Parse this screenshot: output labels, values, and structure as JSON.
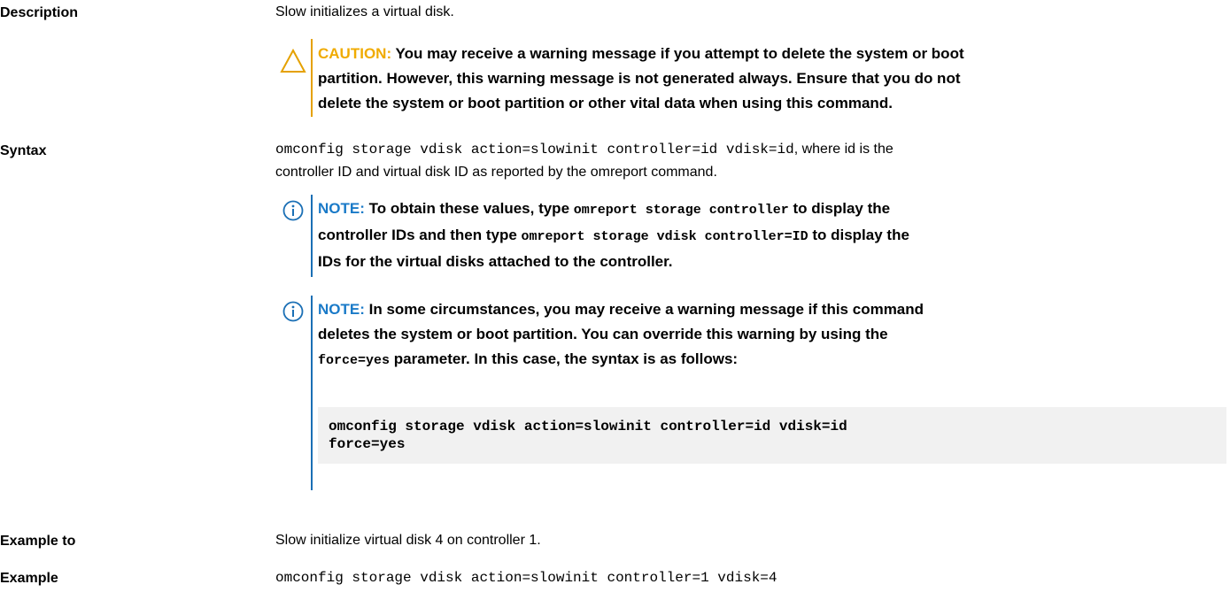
{
  "rows": {
    "description": {
      "label": "Description",
      "text": "Slow initializes a virtual disk."
    },
    "syntax": {
      "label": "Syntax",
      "code": "omconfig storage vdisk action=slowinit controller=id vdisk=id",
      "text_after_code": ", where id is the",
      "text_line2": "controller ID and virtual disk ID as reported by the omreport command."
    },
    "example_to": {
      "label": "Example to",
      "text": "Slow initialize virtual disk 4 on controller 1."
    },
    "example": {
      "label": "Example",
      "code": "omconfig storage vdisk action=slowinit controller=1 vdisk=4"
    }
  },
  "caution": {
    "icon": "warning-triangle-icon",
    "tag": "CAUTION:",
    "text_line1": " You may receive a warning message if you attempt to delete the system or boot",
    "text_line2": "partition. However, this warning message is not generated always. Ensure that you do not",
    "text_line3": "delete the system or boot partition or other vital data when using this command.",
    "accent_color": "#f0ab00"
  },
  "note1": {
    "icon": "info-circle-icon",
    "tag": "NOTE:",
    "part1": " To obtain these values, type ",
    "code1": "omreport storage controller",
    "part2": " to display the",
    "part3": "controller IDs and then type ",
    "code2": "omreport storage vdisk controller=ID",
    "part4": " to display the",
    "part5": "IDs for the virtual disks attached to the controller.",
    "accent_color": "#1a7ac8"
  },
  "note2": {
    "icon": "info-circle-icon",
    "tag": "NOTE:",
    "line1": " In some circumstances, you may receive a warning message if this command",
    "line2": "deletes the system or boot partition. You can override this warning by using the",
    "code": "force=yes",
    "line3_rest": " parameter. In this case, the syntax is as follows:",
    "codeblock_line1": "omconfig storage vdisk action=slowinit controller=id vdisk=id",
    "codeblock_line2": "force=yes"
  }
}
